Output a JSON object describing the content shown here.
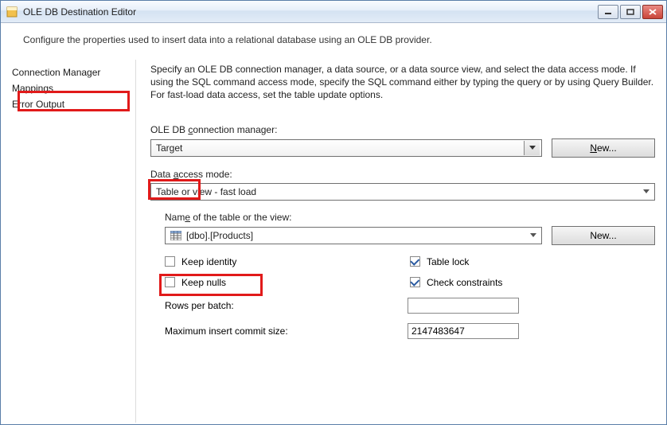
{
  "window": {
    "title": "OLE DB Destination Editor"
  },
  "description": "Configure the properties used to insert data into a relational database using an OLE DB provider.",
  "sidebar": {
    "items": [
      {
        "label": "Connection Manager"
      },
      {
        "label": "Mappings"
      },
      {
        "label": "Error Output"
      }
    ]
  },
  "instructions": "Specify an OLE DB connection manager, a data source, or a data source view, and select the data access mode. If using the SQL command access mode, specify the SQL command either by typing the query or by using Query Builder. For fast-load data access, set the table update options.",
  "fields": {
    "conn_mgr_label_pre": "OLE DB ",
    "conn_mgr_label_u": "c",
    "conn_mgr_label_post": "onnection manager:",
    "conn_mgr_value": "Target",
    "new_btn_u": "N",
    "new_btn_post": "ew...",
    "access_mode_label_pre": "Data ",
    "access_mode_label_u": "a",
    "access_mode_label_post": "ccess mode:",
    "access_mode_value": "Table or view - fast load",
    "table_label_pre": "Nam",
    "table_label_u": "e",
    "table_label_post": " of the table or the view:",
    "table_value": "[dbo].[Products]",
    "new2_btn_label": "New...",
    "keep_identity_u": "K",
    "keep_identity_post": "eep identity",
    "keep_nulls": "Keep nulls",
    "table_lock_u": "T",
    "table_lock_post": "able lock",
    "check_constraints_pre": "Check c",
    "check_constraints_u": "o",
    "check_constraints_post": "nstraints",
    "rows_per_batch_u": "R",
    "rows_per_batch_post": "ows per batch:",
    "rows_per_batch_value": "",
    "max_commit_u": "M",
    "max_commit_post": "aximum insert commit size:",
    "max_commit_value": "2147483647"
  },
  "checks": {
    "keep_identity": false,
    "keep_nulls": false,
    "table_lock": true,
    "check_constraints": true
  }
}
